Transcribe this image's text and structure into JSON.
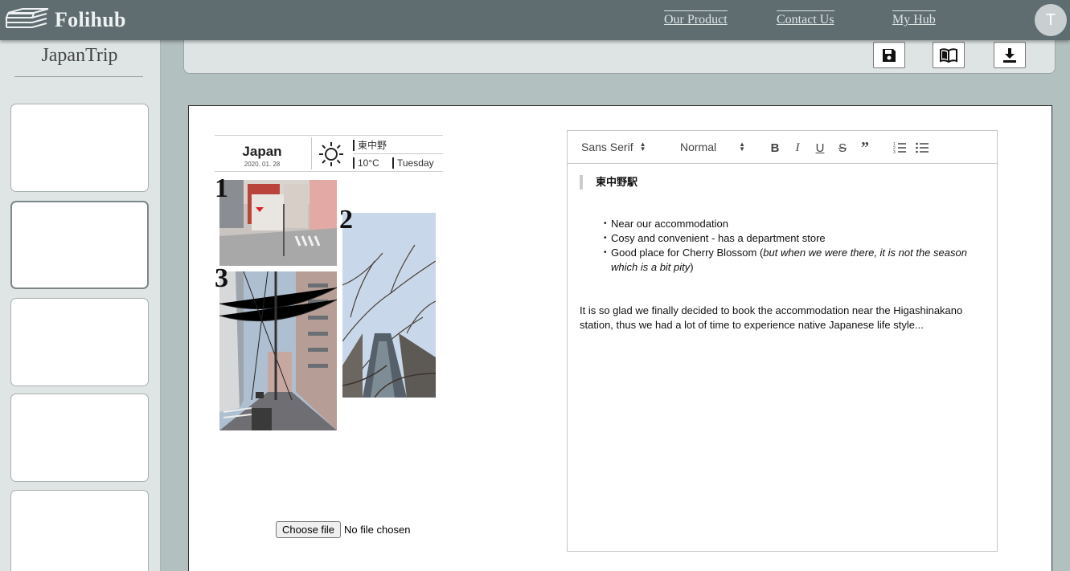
{
  "app": {
    "brand": "Folihub"
  },
  "nav": {
    "links": [
      "Our Product",
      "Contact Us",
      "My Hub"
    ],
    "avatar_letter": "T"
  },
  "sidebar": {
    "title": "JapanTrip",
    "page_count_visible": 5,
    "active_index": 1
  },
  "toolbar": {
    "icons": [
      "save-icon",
      "book-icon",
      "download-icon"
    ]
  },
  "journal": {
    "title": "Japan",
    "date": "2020. 01. 28",
    "location": "東中野",
    "temperature": "10°C",
    "weekday": "Tuesday",
    "photo_numbers": [
      "1",
      "2",
      "3"
    ]
  },
  "file_input": {
    "button_label": "Choose file",
    "status": "No file chosen"
  },
  "editor": {
    "font_select": "Sans Serif",
    "size_select": "Normal",
    "format_icons": [
      "bold-icon",
      "italic-icon",
      "underline-icon",
      "strike-icon",
      "quote-icon",
      "ordered-list-icon",
      "bullet-list-icon"
    ],
    "blockquote": "東中野駅",
    "bullets": [
      "Near our accommodation",
      "Cosy and convenient - has a department store"
    ],
    "bullet3_prefix": "Good place for Cherry Blossom (",
    "bullet3_italic": "but when we were there, it is not the season which is a bit pity",
    "bullet3_suffix": ")",
    "paragraph": "It is so glad we finally decided to book the accommodation near the Higashinakano station, thus we had a lot of time to experience native Japanese life style..."
  }
}
